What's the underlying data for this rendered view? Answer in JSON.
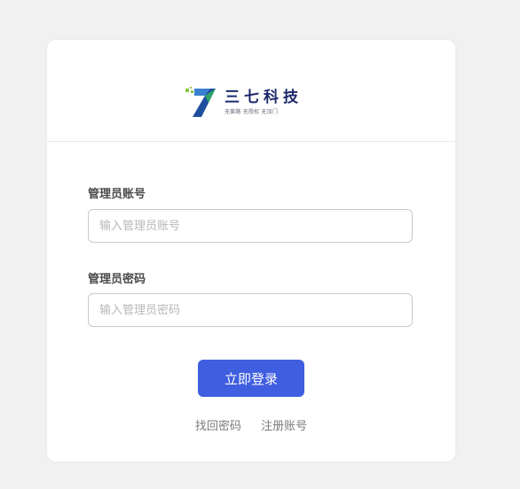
{
  "brand": {
    "name": "三七科技",
    "slogan": "无套路 无授权 无加门"
  },
  "form": {
    "username": {
      "label": "管理员账号",
      "placeholder": "输入管理员账号",
      "value": ""
    },
    "password": {
      "label": "管理员密码",
      "placeholder": "输入管理员密码",
      "value": ""
    },
    "submit_label": "立即登录"
  },
  "links": {
    "forgot_password": "找回密码",
    "register": "注册账号"
  },
  "colors": {
    "accent": "#3f5ee0",
    "brand_navy": "#1d2a6b",
    "brand_green": "#8cc63f",
    "page_bg": "#f0f1f0"
  }
}
